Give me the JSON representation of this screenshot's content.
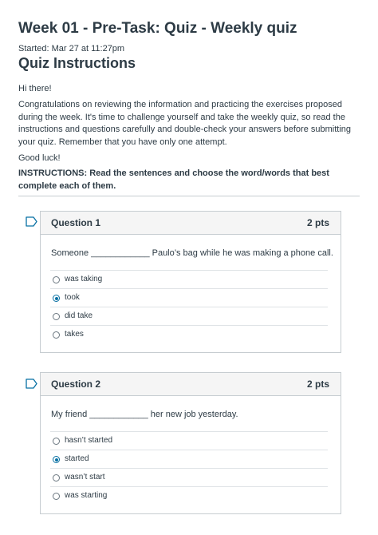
{
  "quiz": {
    "title": "Week 01 - Pre-Task: Quiz - Weekly quiz",
    "started": "Started: Mar 27 at 11:27pm"
  },
  "instructions": {
    "heading": "Quiz Instructions",
    "greeting": "Hi there!",
    "body": "Congratulations on reviewing the information and practicing the exercises proposed during the week. It's time to challenge yourself and take the weekly quiz, so read the instructions and questions carefully and double-check your answers before submitting your quiz. Remember that you have only one attempt.",
    "good_luck": "Good luck!",
    "instructions_text": "INSTRUCTIONS: Read the sentences and choose the word/words that best complete each of them."
  },
  "questions": [
    {
      "name": "Question 1",
      "points": "2 pts",
      "text": "Someone ____________ Paulo’s bag while he was making a phone call.",
      "answers": [
        "was taking",
        "took",
        "did take",
        "takes"
      ],
      "selected": 1
    },
    {
      "name": "Question 2",
      "points": "2 pts",
      "text": "My friend ____________ her new job yesterday.",
      "answers": [
        "hasn’t started",
        "started",
        "wasn’t start",
        "was starting"
      ],
      "selected": 1
    }
  ],
  "colors": {
    "text": "#2d3b45",
    "border": "#c7cdd1",
    "header_bg": "#f5f5f5",
    "selected_radio": "#0770a3"
  }
}
